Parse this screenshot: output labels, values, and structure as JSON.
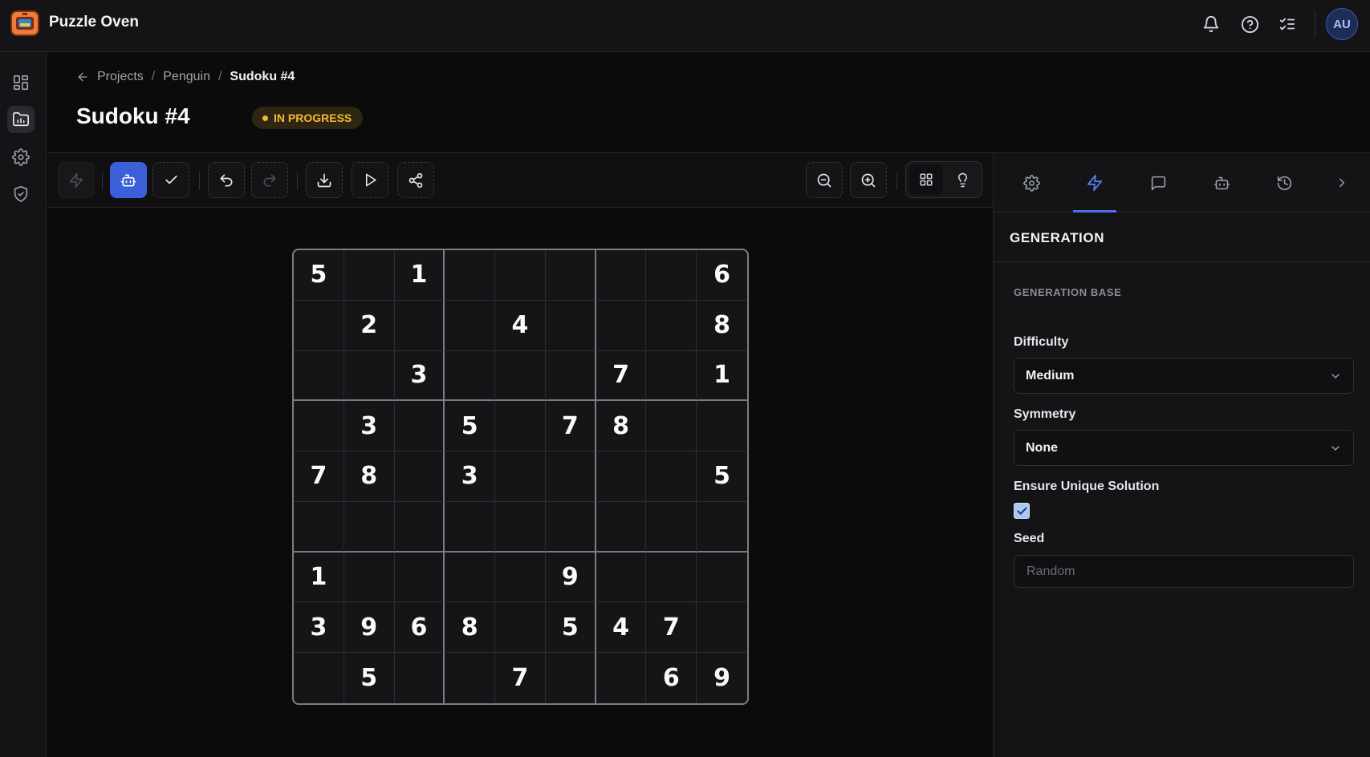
{
  "app": {
    "name": "Puzzle Oven"
  },
  "user": {
    "initials": "AU"
  },
  "breadcrumb": {
    "root": "Projects",
    "parent": "Penguin",
    "current": "Sudoku #4"
  },
  "page": {
    "title": "Sudoku #4",
    "status": "IN PROGRESS"
  },
  "colors": {
    "accent": "#3b5fd9",
    "status": "#f5b82e",
    "background": "#0b0b0c"
  },
  "top_icons": [
    "bell-icon",
    "help-icon",
    "checklist-icon"
  ],
  "rail_icons": [
    "dashboard-icon",
    "projects-icon",
    "settings-icon",
    "shield-icon"
  ],
  "toolbar_icons": [
    "bolt-icon",
    "robot-icon",
    "check-icon",
    "undo-icon",
    "redo-icon",
    "download-icon",
    "play-icon",
    "share-icon",
    "zoom-out-icon",
    "zoom-in-icon",
    "grid-view-icon",
    "hint-icon"
  ],
  "sudoku": {
    "cells": [
      [
        "5",
        "",
        "1",
        "",
        "",
        "",
        "",
        "",
        "6"
      ],
      [
        "",
        "2",
        "",
        "",
        "4",
        "",
        "",
        "",
        "8"
      ],
      [
        "",
        "",
        "3",
        "",
        "",
        "",
        "7",
        "",
        "1"
      ],
      [
        "",
        "3",
        "",
        "5",
        "",
        "7",
        "8",
        "",
        ""
      ],
      [
        "7",
        "8",
        "",
        "3",
        "",
        "",
        "",
        "",
        "5"
      ],
      [
        "",
        "",
        "",
        "",
        "",
        "",
        "",
        "",
        ""
      ],
      [
        "1",
        "",
        "",
        "",
        "",
        "9",
        "",
        "",
        ""
      ],
      [
        "3",
        "9",
        "6",
        "8",
        "",
        "5",
        "4",
        "7",
        ""
      ],
      [
        "",
        "5",
        "",
        "",
        "7",
        "",
        "",
        "6",
        "9"
      ]
    ]
  },
  "panel": {
    "tabs": [
      "settings-icon",
      "bolt-icon",
      "comment-icon",
      "robot-icon",
      "history-icon",
      "chevron-right-icon"
    ],
    "active_tab": "bolt-icon",
    "heading": "GENERATION",
    "section": "GENERATION BASE",
    "difficulty": {
      "label": "Difficulty",
      "value": "Medium"
    },
    "symmetry": {
      "label": "Symmetry",
      "value": "None"
    },
    "unique": {
      "label": "Ensure Unique Solution",
      "checked": true
    },
    "seed": {
      "label": "Seed",
      "placeholder": "Random",
      "value": ""
    }
  }
}
